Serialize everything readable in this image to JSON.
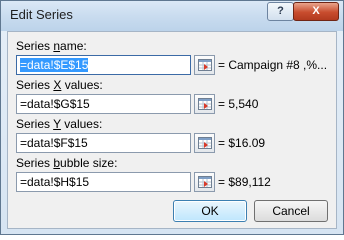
{
  "window": {
    "title": "Edit Series",
    "help_label": "?",
    "close_label": "X"
  },
  "fields": [
    {
      "label_pre": "Series ",
      "label_key": "n",
      "label_post": "ame:",
      "value": "=data!$E$15",
      "preview": "= Campaign #8 ,%..."
    },
    {
      "label_pre": "Series ",
      "label_key": "X",
      "label_post": " values:",
      "value": "=data!$G$15",
      "preview": "= 5,540"
    },
    {
      "label_pre": "Series ",
      "label_key": "Y",
      "label_post": " values:",
      "value": "=data!$F$15",
      "preview": "= $16.09"
    },
    {
      "label_pre": "Series ",
      "label_key": "b",
      "label_post": "ubble size:",
      "value": "=data!$H$15",
      "preview": "= $89,112"
    }
  ],
  "buttons": {
    "ok": "OK",
    "cancel": "Cancel"
  },
  "colors": {
    "selection": "#3399ff",
    "close_button": "#c84c2e",
    "window_frame": "#d6e4f2"
  },
  "icons": {
    "collapse_dialog": "range-picker-icon"
  }
}
